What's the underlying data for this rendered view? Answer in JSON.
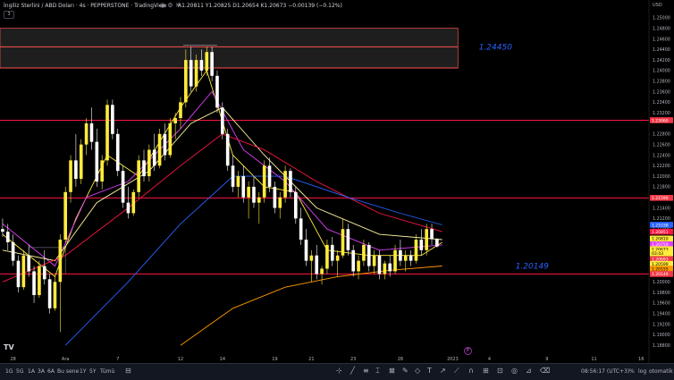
{
  "header": {
    "symbol": "İngiliz Sterlini / ABD Doları · 4s · PEPPERSTONE · TradingView",
    "open": "A1.20811",
    "high": "Y1.20825",
    "low": "D1.20654",
    "close": "K1.20673",
    "change": "−0.00139 (−0.12%)",
    "collapse_label": "3"
  },
  "currency_label": "USD",
  "tv_logo": "TV",
  "event_marker": "P",
  "chart_data": {
    "type": "candlestick",
    "ylim": [
      1.186,
      1.252
    ],
    "y_ticks": [
      {
        "v": 1.25,
        "label": "1.25000"
      },
      {
        "v": 1.248,
        "label": "1.24800"
      },
      {
        "v": 1.246,
        "label": "1.24600"
      },
      {
        "v": 1.244,
        "label": "1.24400"
      },
      {
        "v": 1.242,
        "label": "1.24200"
      },
      {
        "v": 1.24,
        "label": "1.24000"
      },
      {
        "v": 1.238,
        "label": "1.23800"
      },
      {
        "v": 1.236,
        "label": "1.23600"
      },
      {
        "v": 1.234,
        "label": "1.23400"
      },
      {
        "v": 1.232,
        "label": "1.23200"
      },
      {
        "v": 1.228,
        "label": "1.22800"
      },
      {
        "v": 1.226,
        "label": "1.22600"
      },
      {
        "v": 1.224,
        "label": "1.22400"
      },
      {
        "v": 1.222,
        "label": "1.22200"
      },
      {
        "v": 1.22,
        "label": "1.22000"
      },
      {
        "v": 1.218,
        "label": "1.21800"
      },
      {
        "v": 1.214,
        "label": "1.21400"
      },
      {
        "v": 1.212,
        "label": "1.21200"
      },
      {
        "v": 1.21,
        "label": "1.21000"
      },
      {
        "v": 1.2,
        "label": "1.20000"
      },
      {
        "v": 1.198,
        "label": "1.19800"
      },
      {
        "v": 1.196,
        "label": "1.19600"
      },
      {
        "v": 1.194,
        "label": "1.19400"
      },
      {
        "v": 1.192,
        "label": "1.19200"
      },
      {
        "v": 1.19,
        "label": "1.19000"
      },
      {
        "v": 1.188,
        "label": "1.18800"
      }
    ],
    "x_ticks": [
      {
        "i": 2,
        "label": "28"
      },
      {
        "i": 12,
        "label": "Ara"
      },
      {
        "i": 22,
        "label": "7"
      },
      {
        "i": 34,
        "label": "12"
      },
      {
        "i": 42,
        "label": "14"
      },
      {
        "i": 52,
        "label": "19"
      },
      {
        "i": 59,
        "label": "21"
      },
      {
        "i": 67,
        "label": "23"
      },
      {
        "i": 76,
        "label": "28"
      },
      {
        "i": 86,
        "label": "2023"
      },
      {
        "i": 93,
        "label": "4"
      },
      {
        "i": 104,
        "label": "9"
      },
      {
        "i": 113,
        "label": "11"
      },
      {
        "i": 122,
        "label": "16"
      }
    ],
    "total_slots": 124,
    "candles": [
      [
        1.21,
        1.212,
        1.2085,
        1.2095
      ],
      [
        1.2095,
        1.211,
        1.206,
        1.2075
      ],
      [
        1.2075,
        1.209,
        1.203,
        1.204
      ],
      [
        1.204,
        1.205,
        1.198,
        1.199
      ],
      [
        1.199,
        1.206,
        1.1985,
        1.205
      ],
      [
        1.205,
        1.207,
        1.201,
        1.202
      ],
      [
        1.202,
        1.203,
        1.196,
        1.1975
      ],
      [
        1.1975,
        1.204,
        1.197,
        1.203
      ],
      [
        1.203,
        1.206,
        1.1995,
        1.2005
      ],
      [
        1.2005,
        1.2015,
        1.194,
        1.195
      ],
      [
        1.195,
        1.201,
        1.1945,
        1.2
      ],
      [
        1.2,
        1.209,
        1.1905,
        1.208
      ],
      [
        1.208,
        1.218,
        1.2075,
        1.217
      ],
      [
        1.217,
        1.224,
        1.215,
        1.223
      ],
      [
        1.223,
        1.228,
        1.218,
        1.2195
      ],
      [
        1.2195,
        1.227,
        1.2185,
        1.226
      ],
      [
        1.226,
        1.231,
        1.224,
        1.23
      ],
      [
        1.23,
        1.233,
        1.225,
        1.2265
      ],
      [
        1.2265,
        1.229,
        1.218,
        1.219
      ],
      [
        1.219,
        1.224,
        1.2175,
        1.223
      ],
      [
        1.223,
        1.2345,
        1.222,
        1.2335
      ],
      [
        1.2335,
        1.2345,
        1.227,
        1.228
      ],
      [
        1.228,
        1.229,
        1.22,
        1.221
      ],
      [
        1.221,
        1.222,
        1.214,
        1.215
      ],
      [
        1.215,
        1.218,
        1.212,
        1.213
      ],
      [
        1.213,
        1.2175,
        1.2125,
        1.217
      ],
      [
        1.217,
        1.224,
        1.216,
        1.223
      ],
      [
        1.223,
        1.225,
        1.219,
        1.22
      ],
      [
        1.22,
        1.226,
        1.219,
        1.225
      ],
      [
        1.225,
        1.228,
        1.221,
        1.222
      ],
      [
        1.222,
        1.229,
        1.2215,
        1.228
      ],
      [
        1.228,
        1.23,
        1.223,
        1.224
      ],
      [
        1.224,
        1.231,
        1.2235,
        1.23
      ],
      [
        1.23,
        1.232,
        1.227,
        1.231
      ],
      [
        1.231,
        1.235,
        1.229,
        1.234
      ],
      [
        1.234,
        1.244,
        1.233,
        1.242
      ],
      [
        1.242,
        1.2445,
        1.236,
        1.237
      ],
      [
        1.237,
        1.243,
        1.236,
        1.242
      ],
      [
        1.242,
        1.244,
        1.239,
        1.24
      ],
      [
        1.24,
        1.2445,
        1.239,
        1.2435
      ],
      [
        1.2435,
        1.2445,
        1.238,
        1.239
      ],
      [
        1.239,
        1.24,
        1.232,
        1.233
      ],
      [
        1.233,
        1.234,
        1.227,
        1.228
      ],
      [
        1.228,
        1.229,
        1.221,
        1.222
      ],
      [
        1.222,
        1.224,
        1.217,
        1.218
      ],
      [
        1.218,
        1.221,
        1.216,
        1.22
      ],
      [
        1.22,
        1.222,
        1.215,
        1.216
      ],
      [
        1.216,
        1.219,
        1.212,
        1.218
      ],
      [
        1.218,
        1.22,
        1.214,
        1.215
      ],
      [
        1.215,
        1.217,
        1.211,
        1.216
      ],
      [
        1.216,
        1.223,
        1.215,
        1.222
      ],
      [
        1.222,
        1.2235,
        1.217,
        1.218
      ],
      [
        1.218,
        1.219,
        1.213,
        1.214
      ],
      [
        1.214,
        1.217,
        1.212,
        1.216
      ],
      [
        1.216,
        1.222,
        1.215,
        1.221
      ],
      [
        1.221,
        1.2215,
        1.216,
        1.217
      ],
      [
        1.217,
        1.218,
        1.211,
        1.212
      ],
      [
        1.212,
        1.214,
        1.207,
        1.208
      ],
      [
        1.208,
        1.21,
        1.203,
        1.204
      ],
      [
        1.204,
        1.206,
        1.2,
        1.205
      ],
      [
        1.205,
        1.207,
        1.2005,
        1.2015
      ],
      [
        1.2015,
        1.203,
        1.1995,
        1.2025
      ],
      [
        1.2025,
        1.208,
        1.2015,
        1.207
      ],
      [
        1.207,
        1.2085,
        1.203,
        1.204
      ],
      [
        1.204,
        1.206,
        1.201,
        1.205
      ],
      [
        1.205,
        1.212,
        1.2045,
        1.21
      ],
      [
        1.21,
        1.211,
        1.205,
        1.206
      ],
      [
        1.206,
        1.207,
        1.201,
        1.202
      ],
      [
        1.202,
        1.205,
        1.2005,
        1.204
      ],
      [
        1.204,
        1.208,
        1.203,
        1.207
      ],
      [
        1.207,
        1.2075,
        1.202,
        1.203
      ],
      [
        1.203,
        1.206,
        1.2015,
        1.205
      ],
      [
        1.205,
        1.206,
        1.2005,
        1.2015
      ],
      [
        1.2015,
        1.204,
        1.2005,
        1.2035
      ],
      [
        1.2035,
        1.205,
        1.201,
        1.202
      ],
      [
        1.202,
        1.207,
        1.2015,
        1.206
      ],
      [
        1.206,
        1.208,
        1.203,
        1.204
      ],
      [
        1.204,
        1.206,
        1.202,
        1.205
      ],
      [
        1.205,
        1.206,
        1.203,
        1.204
      ],
      [
        1.204,
        1.209,
        1.2035,
        1.208
      ],
      [
        1.208,
        1.21,
        1.205,
        1.206
      ],
      [
        1.206,
        1.211,
        1.205,
        1.21
      ],
      [
        1.21,
        1.211,
        1.207,
        1.2081
      ],
      [
        1.2081,
        1.2083,
        1.2065,
        1.2067
      ]
    ],
    "ma_series": [
      {
        "color": "#ffeb3b",
        "pts": [
          [
            0,
            1.209
          ],
          [
            10,
            1.201
          ],
          [
            14,
            1.212
          ],
          [
            20,
            1.224
          ],
          [
            26,
            1.22
          ],
          [
            34,
            1.233
          ],
          [
            39,
            1.24
          ],
          [
            44,
            1.224
          ],
          [
            50,
            1.218
          ],
          [
            56,
            1.217
          ],
          [
            62,
            1.206
          ],
          [
            70,
            1.205
          ],
          [
            80,
            1.205
          ],
          [
            84,
            1.2075
          ]
        ]
      },
      {
        "color": "#e040fb",
        "pts": [
          [
            0,
            1.211
          ],
          [
            10,
            1.203
          ],
          [
            16,
            1.216
          ],
          [
            24,
            1.219
          ],
          [
            34,
            1.229
          ],
          [
            40,
            1.236
          ],
          [
            46,
            1.225
          ],
          [
            54,
            1.219
          ],
          [
            62,
            1.21
          ],
          [
            72,
            1.206
          ],
          [
            84,
            1.207
          ]
        ]
      },
      {
        "color": "#fff59d",
        "pts": [
          [
            0,
            1.206
          ],
          [
            10,
            1.204
          ],
          [
            18,
            1.215
          ],
          [
            28,
            1.221
          ],
          [
            36,
            1.23
          ],
          [
            42,
            1.233
          ],
          [
            50,
            1.224
          ],
          [
            60,
            1.214
          ],
          [
            72,
            1.209
          ],
          [
            84,
            1.208
          ]
        ]
      },
      {
        "color": "#ff1744",
        "pts": [
          [
            0,
            1.2
          ],
          [
            12,
            1.205
          ],
          [
            24,
            1.214
          ],
          [
            34,
            1.222
          ],
          [
            42,
            1.228
          ],
          [
            50,
            1.225
          ],
          [
            60,
            1.219
          ],
          [
            72,
            1.213
          ],
          [
            84,
            1.2095
          ]
        ]
      },
      {
        "color": "#2962ff",
        "pts": [
          [
            12,
            1.188
          ],
          [
            24,
            1.2
          ],
          [
            34,
            1.211
          ],
          [
            44,
            1.22
          ],
          [
            54,
            1.22
          ],
          [
            66,
            1.216
          ],
          [
            76,
            1.213
          ],
          [
            84,
            1.2108
          ]
        ]
      },
      {
        "color": "#ff9800",
        "pts": [
          [
            34,
            1.188
          ],
          [
            44,
            1.195
          ],
          [
            54,
            1.199
          ],
          [
            64,
            1.201
          ],
          [
            74,
            1.2022
          ],
          [
            84,
            1.203
          ]
        ]
      }
    ],
    "zone": {
      "i0": 0,
      "i1": 87,
      "y_top": 1.248,
      "y_bottom": 1.2405
    },
    "box_small": {
      "i0": 5,
      "i1": 12,
      "y_top": 1.2065,
      "y_bottom": 1.2015
    },
    "hlines": [
      {
        "v": 1.2445,
        "color": "#ff5252",
        "i0": 0,
        "i1": 87
      },
      {
        "v": 1.2405,
        "color": "#ff5252",
        "i0": 0,
        "i1": 87
      },
      {
        "v": 1.2306,
        "color": "#ff1744",
        "i0": 0,
        "i1": 124
      },
      {
        "v": 1.2159,
        "color": "#ff1744",
        "i0": 0,
        "i1": 124
      },
      {
        "v": 1.2015,
        "color": "#ff1744",
        "i0": 0,
        "i1": 124
      },
      {
        "v": 1.2448,
        "color": "#787b86",
        "i0": 35,
        "i1": 41
      }
    ],
    "annotations": [
      {
        "i": 91,
        "v": 1.2445,
        "text": "1.24450"
      },
      {
        "i": 98,
        "v": 1.203,
        "text": "1.20149"
      }
    ],
    "price_tags": [
      {
        "v": 1.2306,
        "label": "1.23060",
        "bg": "#f23645",
        "fg": "#ffffff"
      },
      {
        "v": 1.2159,
        "label": "1.21590",
        "bg": "#f23645",
        "fg": "#ffffff"
      },
      {
        "v": 1.2108,
        "label": "1.21038",
        "bg": "#2962ff",
        "fg": "#ffffff"
      },
      {
        "v": 1.2095,
        "label": "1.20851",
        "bg": "#ff1744",
        "fg": "#ffffff"
      },
      {
        "v": 1.2082,
        "label": "1.20810",
        "bg": "#ffeb3b",
        "fg": "#000000"
      },
      {
        "v": 1.2071,
        "label": "1.20759",
        "bg": "#e040fb",
        "fg": "#ffffff"
      },
      {
        "v": 1.2062,
        "label": "1.20673",
        "bg": "#ffeb3b",
        "fg": "#000000"
      },
      {
        "v": 1.2054,
        "label": "03:43",
        "bg": "#ffeb3b",
        "fg": "#000000"
      },
      {
        "v": 1.2043,
        "label": "1.20693",
        "bg": "#f23645",
        "fg": "#ffffff"
      },
      {
        "v": 1.2034,
        "label": "1.20599",
        "bg": "#ffeb3b",
        "fg": "#000000"
      },
      {
        "v": 1.2025,
        "label": "1.20155",
        "bg": "#ff9800",
        "fg": "#000000"
      },
      {
        "v": 1.2015,
        "label": "1.20149",
        "bg": "#f23645",
        "fg": "#ffffff"
      }
    ]
  },
  "bottom": {
    "timeframes": [
      "1G",
      "5G",
      "1A",
      "3A",
      "6A",
      "Bu sene",
      "1Y",
      "5Y",
      "Tümü"
    ],
    "clock": "08:56:17 (UTC+3)",
    "percent": "%",
    "log": "log",
    "auto": "otomatik"
  }
}
